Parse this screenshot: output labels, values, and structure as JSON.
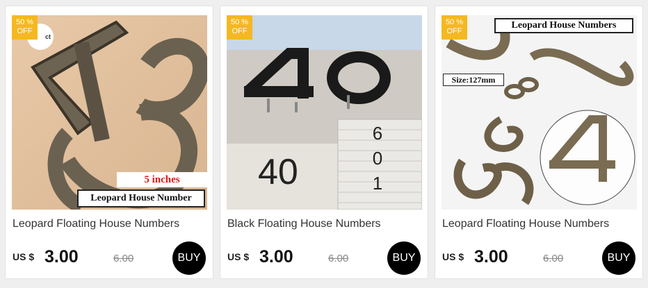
{
  "colors": {
    "badge": "#f5b820",
    "buy_button": "#000000",
    "page_bg": "#efefef"
  },
  "products": [
    {
      "badge": {
        "line1": "50 %",
        "line2": "OFF"
      },
      "image": {
        "overlay_size": "5 inches",
        "overlay_label": "Leopard House Number",
        "sticker_text": "ct"
      },
      "title": "Leopard Floating House Numbers",
      "currency": "US $",
      "price": "3.00",
      "old_price": "6.00",
      "buy_label": "BUY"
    },
    {
      "badge": {
        "line1": "50 %",
        "line2": "OFF"
      },
      "image": {
        "big_number": "40",
        "wall_number": "40",
        "vertical_digits": [
          "6",
          "0",
          "1"
        ]
      },
      "title": "Black Floating House Numbers",
      "currency": "US $",
      "price": "3.00",
      "old_price": "6.00",
      "buy_label": "BUY"
    },
    {
      "badge": {
        "line1": "50 %",
        "line2": "OFF"
      },
      "image": {
        "overlay_label": "Leopard House Numbers",
        "overlay_size": "Size:127mm"
      },
      "title": "Leopard Floating House Numbers",
      "currency": "US $",
      "price": "3.00",
      "old_price": "6.00",
      "buy_label": "BUY"
    }
  ]
}
